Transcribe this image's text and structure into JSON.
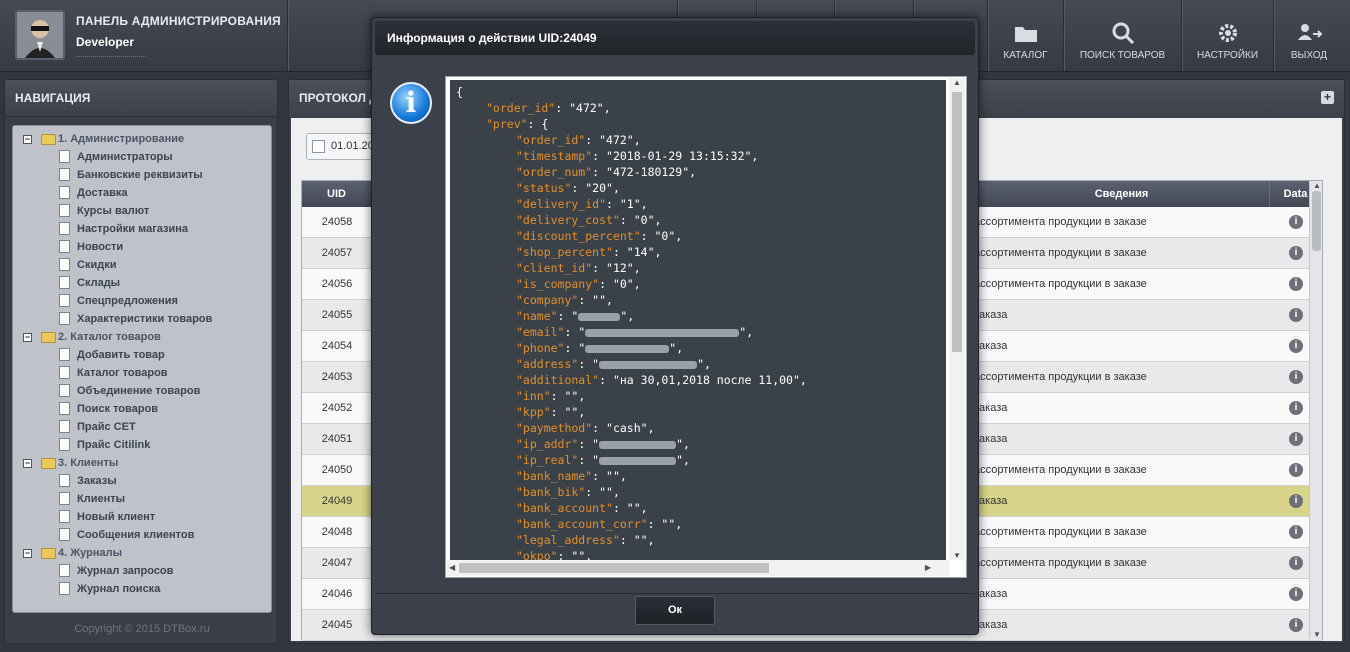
{
  "header": {
    "title": "ПАНЕЛЬ АДМИНИСТРИРОВАНИЯ",
    "user": "Developer",
    "nav": [
      {
        "label": "КАТАЛОГ",
        "icon": "folder-icon"
      },
      {
        "label": "ПОИСК ТОВАРОВ",
        "icon": "search-icon"
      },
      {
        "label": "НАСТРОЙКИ",
        "icon": "gear-icon"
      },
      {
        "label": "ВЫХОД",
        "icon": "logout-icon"
      }
    ]
  },
  "sidebar": {
    "title": "НАВИГАЦИЯ",
    "groups": [
      {
        "label": "1. Администрирование",
        "items": [
          "Администраторы",
          "Банковские реквизиты",
          "Доставка",
          "Курсы валют",
          "Настройки магазина",
          "Новости",
          "Скидки",
          "Склады",
          "Спецпредложения",
          "Характеристики товаров"
        ]
      },
      {
        "label": "2. Каталог товаров",
        "items": [
          "Добавить товар",
          "Каталог товаров",
          "Объединение товаров",
          "Поиск товаров",
          "Прайс CET",
          "Прайс Citilink"
        ]
      },
      {
        "label": "3. Клиенты",
        "items": [
          "Заказы",
          "Клиенты",
          "Новый клиент",
          "Сообщения клиентов"
        ]
      },
      {
        "label": "4. Журналы",
        "items": [
          "Журнал запросов",
          "Журнал поиска"
        ]
      }
    ],
    "copyright": "Copyright © 2015 DTBox.ru"
  },
  "main": {
    "title": "ПРОТОКОЛ Д",
    "date": "01.01.20",
    "columns": {
      "uid": "UID",
      "info": "Сведения",
      "data": "Data"
    },
    "rows": [
      {
        "uid": "24058",
        "info": "ассортимента продукции в заказе"
      },
      {
        "uid": "24057",
        "info": "ассортимента продукции в заказе"
      },
      {
        "uid": "24056",
        "info": "ассортимента продукции в заказе"
      },
      {
        "uid": "24055",
        "info": "заказа"
      },
      {
        "uid": "24054",
        "info": "заказа"
      },
      {
        "uid": "24053",
        "info": "ассортимента продукции в заказе"
      },
      {
        "uid": "24052",
        "info": "заказа"
      },
      {
        "uid": "24051",
        "info": "заказа"
      },
      {
        "uid": "24050",
        "info": "ассортимента продукции в заказе"
      },
      {
        "uid": "24049",
        "info": "заказа",
        "selected": true
      },
      {
        "uid": "24048",
        "info": "ассортимента продукции в заказе"
      },
      {
        "uid": "24047",
        "info": "ассортимента продукции в заказе"
      },
      {
        "uid": "24046",
        "info": "заказа"
      },
      {
        "uid": "24045",
        "info": "заказа"
      }
    ]
  },
  "modal": {
    "title": "Информация о действии UID:24049",
    "ok_label": "Ок",
    "json_lines": [
      {
        "indent": 0,
        "text": "{"
      },
      {
        "indent": 1,
        "key": "\"order_id\"",
        "val": " \"472\","
      },
      {
        "indent": 1,
        "key": "\"prev\"",
        "val": " {"
      },
      {
        "indent": 2,
        "key": "\"order_id\"",
        "val": " \"472\","
      },
      {
        "indent": 2,
        "key": "\"timestamp\"",
        "val": " \"2018-01-29 13:15:32\","
      },
      {
        "indent": 2,
        "key": "\"order_num\"",
        "val": " \"472-180129\","
      },
      {
        "indent": 2,
        "key": "\"status\"",
        "val": " \"20\","
      },
      {
        "indent": 2,
        "key": "\"delivery_id\"",
        "val": " \"1\","
      },
      {
        "indent": 2,
        "key": "\"delivery_cost\"",
        "val": " \"0\","
      },
      {
        "indent": 2,
        "key": "\"discount_percent\"",
        "val": " \"0\","
      },
      {
        "indent": 2,
        "key": "\"shop_percent\"",
        "val": " \"14\","
      },
      {
        "indent": 2,
        "key": "\"client_id\"",
        "val": " \"12\","
      },
      {
        "indent": 2,
        "key": "\"is_company\"",
        "val": " \"0\","
      },
      {
        "indent": 2,
        "key": "\"company\"",
        "val": " \"\","
      },
      {
        "indent": 2,
        "key": "\"name\"",
        "val": " \"",
        "blur": 6,
        "tail": "\","
      },
      {
        "indent": 2,
        "key": "\"email\"",
        "val": " \"",
        "blur": 22,
        "tail": "\","
      },
      {
        "indent": 2,
        "key": "\"phone\"",
        "val": " \"",
        "blur": 12,
        "tail": "\","
      },
      {
        "indent": 2,
        "key": "\"address\"",
        "val": " \"",
        "blur": 14,
        "tail": "\","
      },
      {
        "indent": 2,
        "key": "\"additional\"",
        "val": " \"на 30,01,2018 после 11,00\","
      },
      {
        "indent": 2,
        "key": "\"inn\"",
        "val": " \"\","
      },
      {
        "indent": 2,
        "key": "\"kpp\"",
        "val": " \"\","
      },
      {
        "indent": 2,
        "key": "\"paymethod\"",
        "val": " \"cash\","
      },
      {
        "indent": 2,
        "key": "\"ip_addr\"",
        "val": " \"",
        "blur": 11,
        "tail": "\","
      },
      {
        "indent": 2,
        "key": "\"ip_real\"",
        "val": " \"",
        "blur": 11,
        "tail": "\","
      },
      {
        "indent": 2,
        "key": "\"bank_name\"",
        "val": " \"\","
      },
      {
        "indent": 2,
        "key": "\"bank_bik\"",
        "val": " \"\","
      },
      {
        "indent": 2,
        "key": "\"bank_account\"",
        "val": " \"\","
      },
      {
        "indent": 2,
        "key": "\"bank_account_corr\"",
        "val": " \"\","
      },
      {
        "indent": 2,
        "key": "\"legal_address\"",
        "val": " \"\","
      },
      {
        "indent": 2,
        "key": "\"okpo\"",
        "val": " \"\","
      }
    ]
  }
}
